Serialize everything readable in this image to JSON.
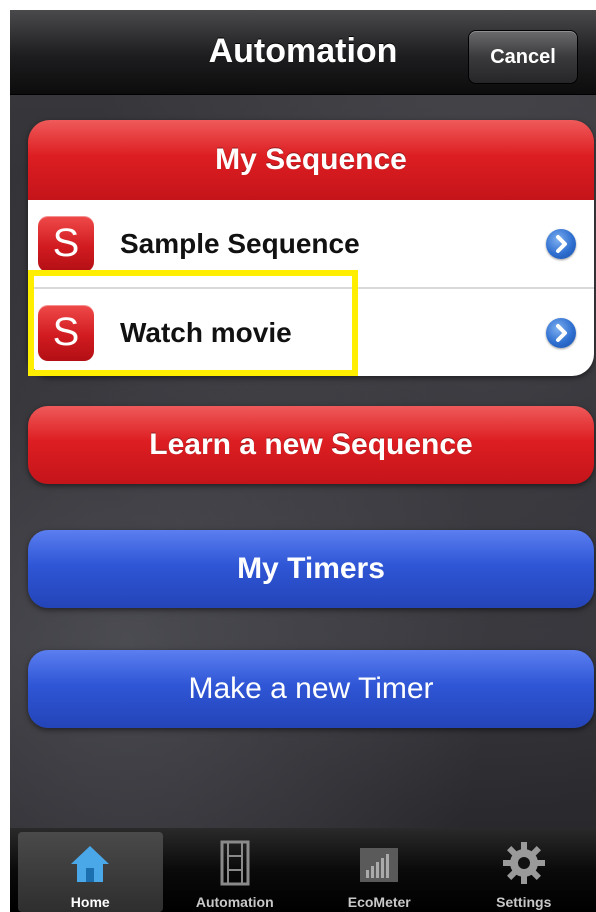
{
  "nav": {
    "title": "Automation",
    "cancel_label": "Cancel"
  },
  "sequence_group": {
    "header": "My Sequence",
    "items": [
      {
        "icon_letter": "S",
        "label": "Sample Sequence"
      },
      {
        "icon_letter": "S",
        "label": "Watch movie"
      }
    ]
  },
  "buttons": {
    "learn_sequence": "Learn a new Sequence",
    "my_timers": "My Timers",
    "make_timer": "Make a new Timer"
  },
  "tabbar": {
    "items": [
      {
        "label": "Home",
        "icon": "home-icon"
      },
      {
        "label": "Automation",
        "icon": "film-icon"
      },
      {
        "label": "EcoMeter",
        "icon": "bar-meter-icon"
      },
      {
        "label": "Settings",
        "icon": "gear-icon"
      }
    ],
    "active_index": 0
  },
  "colors": {
    "red": "#dd1e22",
    "blue": "#2f56d6",
    "highlight": "#ffee00",
    "disclosure": "#2e6fd0"
  }
}
